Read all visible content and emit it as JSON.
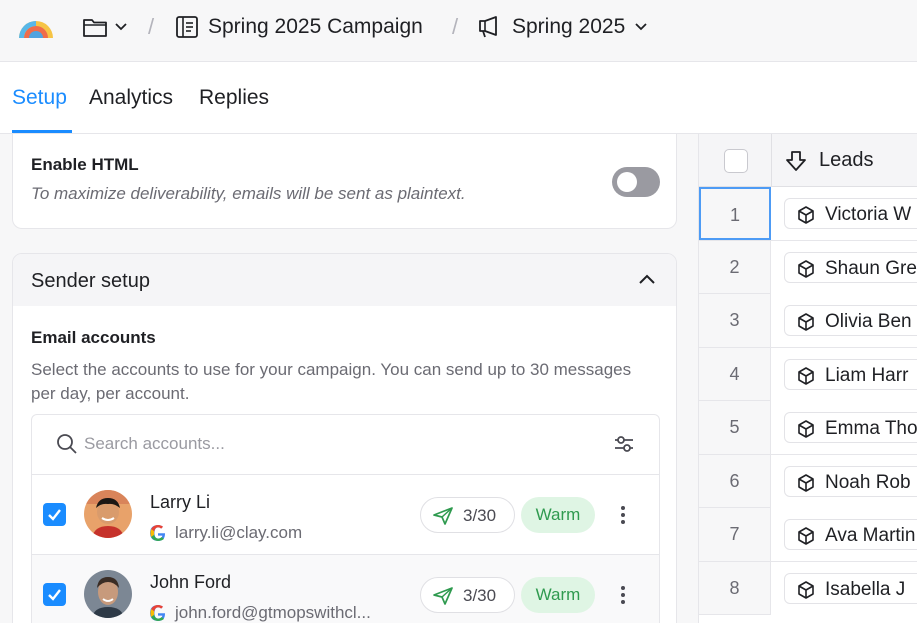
{
  "breadcrumb": {
    "campaign": "Spring 2025 Campaign",
    "sequence": "Spring 2025"
  },
  "tabs": [
    {
      "label": "Setup",
      "active": true
    },
    {
      "label": "Analytics",
      "active": false
    },
    {
      "label": "Replies",
      "active": false
    }
  ],
  "enable_html": {
    "title": "Enable HTML",
    "description": "To maximize deliverability, emails will be sent as plaintext.",
    "enabled": false
  },
  "sender_setup": {
    "title": "Sender setup",
    "email_accounts_title": "Email accounts",
    "email_accounts_desc": "Select the accounts to use for your campaign. You can send up to 30 messages per day, per account.",
    "search_placeholder": "Search accounts...",
    "accounts": [
      {
        "name": "Larry Li",
        "email": "larry.li@clay.com",
        "sent": "3/30",
        "status": "Warm",
        "checked": true
      },
      {
        "name": "John Ford",
        "email": "john.ford@gtmopswithcl...",
        "sent": "3/30",
        "status": "Warm",
        "checked": true
      }
    ]
  },
  "leads_table": {
    "column_label": "Leads",
    "rows": [
      {
        "index": "1",
        "name": "Victoria W"
      },
      {
        "index": "2",
        "name": "Shaun Gre"
      },
      {
        "index": "3",
        "name": "Olivia Ben"
      },
      {
        "index": "4",
        "name": "Liam Harr"
      },
      {
        "index": "5",
        "name": "Emma Tho"
      },
      {
        "index": "6",
        "name": "Noah Rob"
      },
      {
        "index": "7",
        "name": "Ava Martin"
      },
      {
        "index": "8",
        "name": "Isabella J"
      }
    ]
  },
  "colors": {
    "accent": "#1a8cff",
    "warm_bg": "#dff5e4",
    "warm_text": "#2f9a4f"
  }
}
